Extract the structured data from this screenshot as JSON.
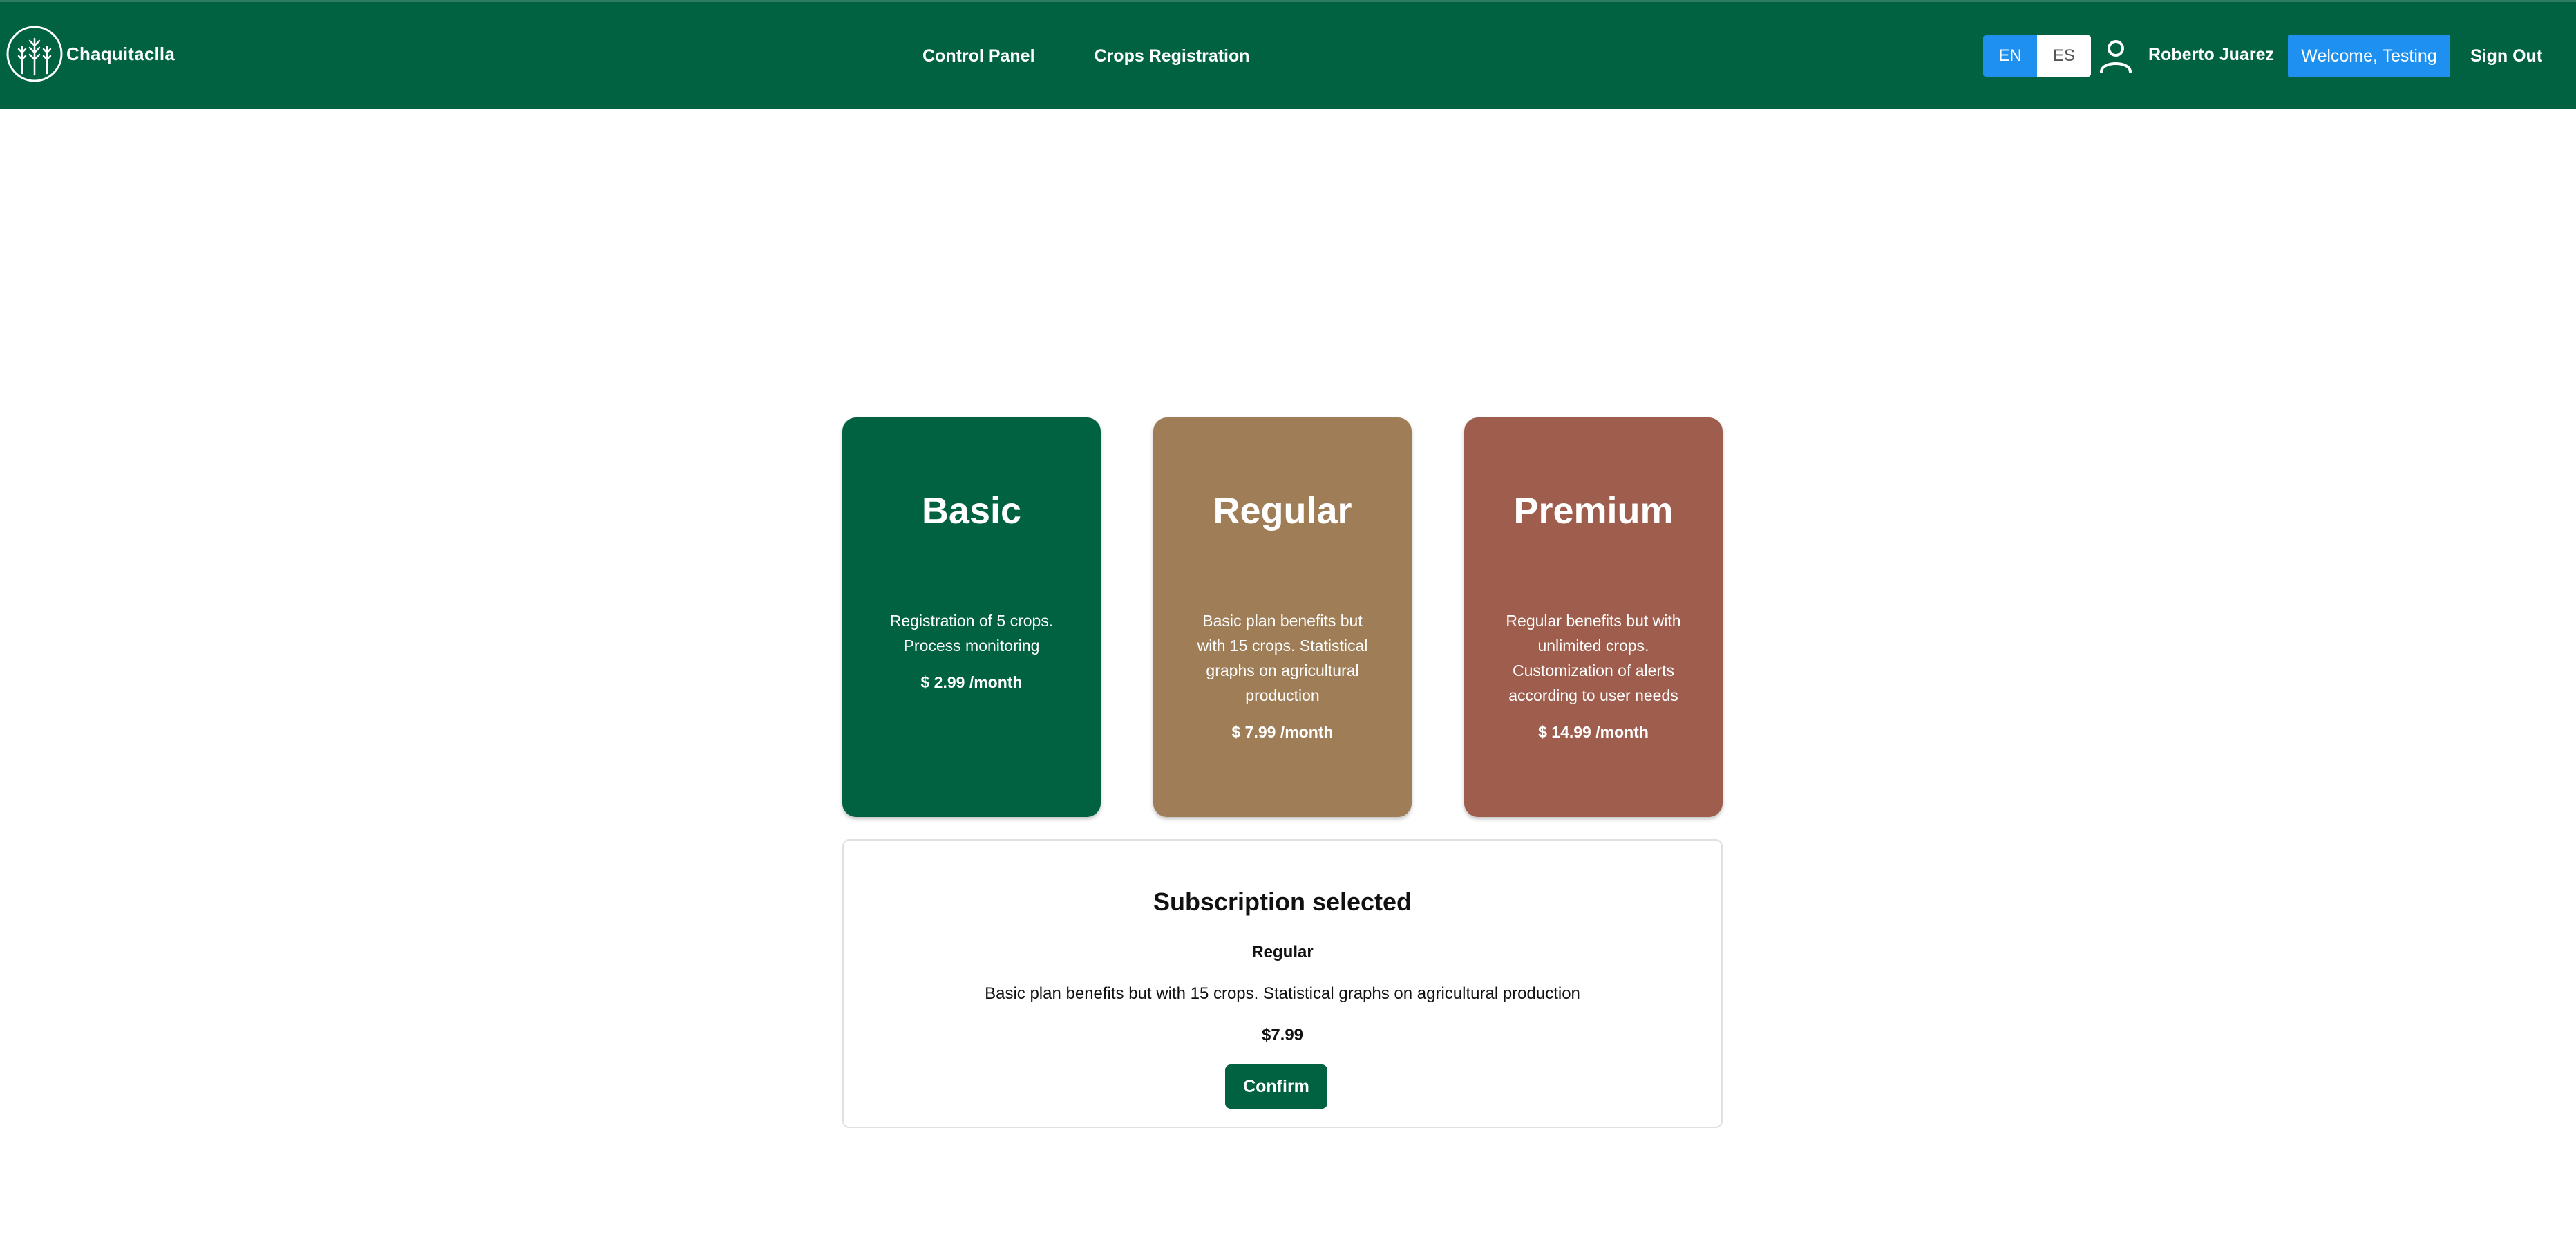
{
  "brand": {
    "name": "Chaquitaclla",
    "logo_icon": "wheat-logo-icon"
  },
  "nav": {
    "items": [
      {
        "label": "Control Panel"
      },
      {
        "label": "Crops Registration"
      }
    ]
  },
  "language": {
    "options": [
      "EN",
      "ES"
    ],
    "selected": "EN"
  },
  "user": {
    "icon": "user-icon",
    "name": "Roberto Juarez",
    "welcome_label": "Welcome, Testing",
    "signout_label": "Sign Out"
  },
  "plans": [
    {
      "title": "Basic",
      "description": "Registration of 5 crops. Process monitoring",
      "price": "$ 2.99 /month",
      "color": "#006241"
    },
    {
      "title": "Regular",
      "description": "Basic plan benefits but with 15 crops. Statistical graphs on agricultural production",
      "price": "$ 7.99 /month",
      "color": "#9e7d57"
    },
    {
      "title": "Premium",
      "description": "Regular benefits but with unlimited crops. Customization of alerts according to user needs",
      "price": "$ 14.99 /month",
      "color": "#9e5d4d"
    }
  ],
  "selection": {
    "heading": "Subscription selected",
    "plan_name": "Regular",
    "description": "Basic plan benefits but with 15 crops. Statistical graphs on agricultural production",
    "price": "$7.99",
    "confirm_label": "Confirm"
  },
  "colors": {
    "header_bg": "#006241",
    "accent_blue": "#1e90f0",
    "confirm_bg": "#006241"
  }
}
